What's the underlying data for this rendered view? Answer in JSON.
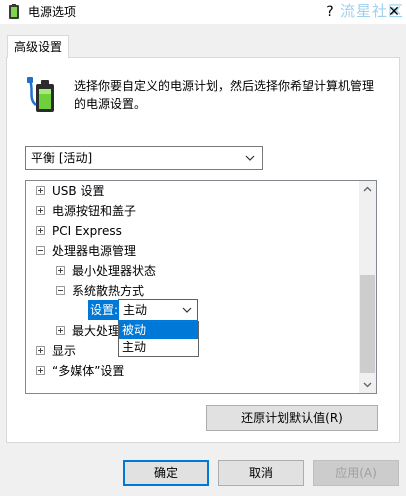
{
  "window": {
    "title": "电源选项",
    "help_label": "?",
    "close_label": "✕",
    "watermark": "流星社区"
  },
  "tab": {
    "label": "高级设置"
  },
  "description": "选择你要自定义的电源计划，然后选择你希望计算机管理的电源设置。",
  "plan_select": {
    "value": "平衡 [活动]"
  },
  "tree": {
    "items": [
      {
        "label": "USB 设置",
        "level": 0,
        "expanded": false
      },
      {
        "label": "电源按钮和盖子",
        "level": 0,
        "expanded": false
      },
      {
        "label": "PCI Express",
        "level": 0,
        "expanded": false
      },
      {
        "label": "处理器电源管理",
        "level": 0,
        "expanded": true
      },
      {
        "label": "最小处理器状态",
        "level": 1,
        "expanded": false
      },
      {
        "label": "系统散热方式",
        "level": 1,
        "expanded": true
      },
      {
        "label": "最大处理器状态",
        "level": 1,
        "expanded": false
      },
      {
        "label": "显示",
        "level": 0,
        "expanded": false
      },
      {
        "label": "“多媒体”设置",
        "level": 0,
        "expanded": false
      }
    ],
    "setting": {
      "label": "设置:",
      "value": "主动",
      "options": [
        "被动",
        "主动"
      ],
      "highlighted": "被动"
    }
  },
  "buttons": {
    "restore": "还原计划默认值(R)",
    "ok": "确定",
    "cancel": "取消",
    "apply": "应用(A)"
  },
  "colors": {
    "accent": "#0078d7",
    "watermark": "#9fd0ee"
  }
}
